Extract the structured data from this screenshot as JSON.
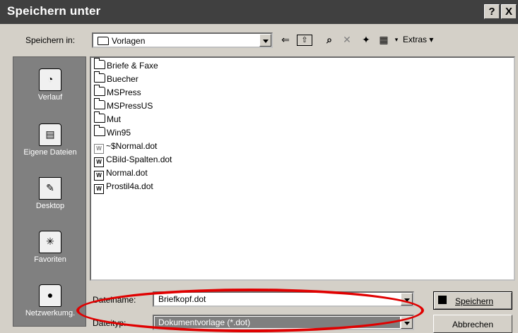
{
  "window": {
    "title": "Speichern unter",
    "help_label": "?",
    "close_label": "X"
  },
  "toolbar": {
    "save_in_label": "Speichern in:",
    "current_folder": "Vorlagen",
    "back_glyph": "⇐",
    "up_glyph": "⇧",
    "search_glyph": "⌕",
    "delete_glyph": "✕",
    "new_folder_glyph": "✦",
    "views_glyph": "▦",
    "extras_label": "Extras"
  },
  "places": [
    {
      "label": "Verlauf",
      "icon": "history-icon"
    },
    {
      "label": "Eigene Dateien",
      "icon": "my-documents-icon"
    },
    {
      "label": "Desktop",
      "icon": "desktop-icon"
    },
    {
      "label": "Favoriten",
      "icon": "favorites-icon"
    },
    {
      "label": "Netzwerkumg.",
      "icon": "network-icon"
    }
  ],
  "files": [
    {
      "name": "Briefe & Faxe",
      "type": "folder"
    },
    {
      "name": "Buecher",
      "type": "folder"
    },
    {
      "name": "MSPress",
      "type": "folder"
    },
    {
      "name": "MSPressUS",
      "type": "folder"
    },
    {
      "name": "Mut",
      "type": "folder"
    },
    {
      "name": "Win95",
      "type": "folder"
    },
    {
      "name": "~$Normal.dot",
      "type": "word-hidden"
    },
    {
      "name": "CBild-Spalten.dot",
      "type": "word"
    },
    {
      "name": "Normal.dot",
      "type": "word"
    },
    {
      "name": "Prostil4a.dot",
      "type": "word"
    }
  ],
  "bottom": {
    "filename_label": "Dateiname:",
    "filename_value": "Briefkopf.dot",
    "filetype_label": "Dateityp:",
    "filetype_value": "Dokumentvorlage (*.dot)",
    "save_button": "Speichern",
    "cancel_button": "Abbrechen"
  },
  "colors": {
    "annotation": "#e00000",
    "selection": "#7f7f7f"
  }
}
